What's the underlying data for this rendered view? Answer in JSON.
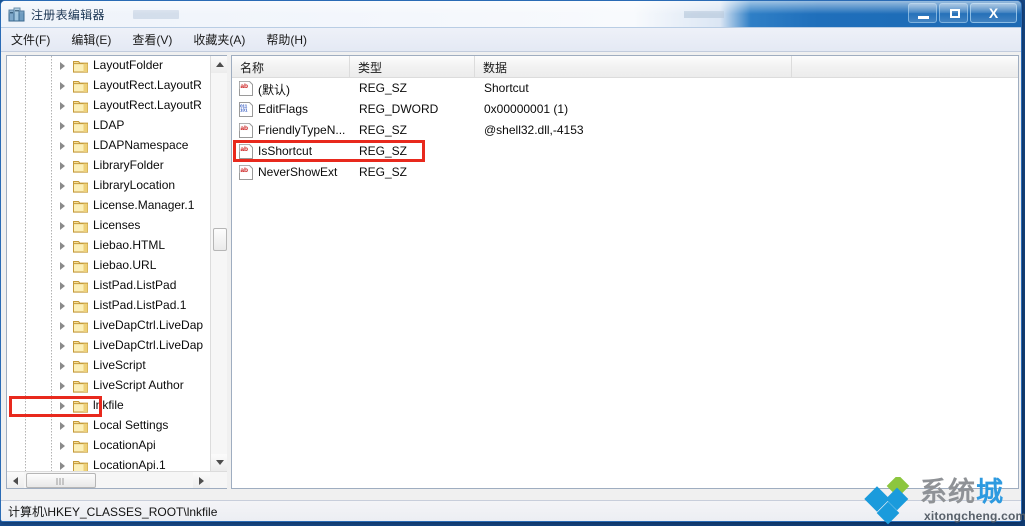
{
  "window": {
    "title": "注册表编辑器",
    "app_icon": "registry-editor-icon",
    "controls": {
      "minimize": "–",
      "maximize": "□",
      "close": "X"
    }
  },
  "menubar": {
    "items": [
      {
        "label": "文件(F)",
        "name": "menu-file"
      },
      {
        "label": "编辑(E)",
        "name": "menu-edit"
      },
      {
        "label": "查看(V)",
        "name": "menu-view"
      },
      {
        "label": "收藏夹(A)",
        "name": "menu-favorites"
      },
      {
        "label": "帮助(H)",
        "name": "menu-help"
      }
    ]
  },
  "tree": {
    "items": [
      {
        "label": "LayoutFolder",
        "highlighted": false
      },
      {
        "label": "LayoutRect.LayoutR",
        "highlighted": false
      },
      {
        "label": "LayoutRect.LayoutR",
        "highlighted": false
      },
      {
        "label": "LDAP",
        "highlighted": false
      },
      {
        "label": "LDAPNamespace",
        "highlighted": false
      },
      {
        "label": "LibraryFolder",
        "highlighted": false
      },
      {
        "label": "LibraryLocation",
        "highlighted": false
      },
      {
        "label": "License.Manager.1",
        "highlighted": false
      },
      {
        "label": "Licenses",
        "highlighted": false
      },
      {
        "label": "Liebao.HTML",
        "highlighted": false
      },
      {
        "label": "Liebao.URL",
        "highlighted": false
      },
      {
        "label": "ListPad.ListPad",
        "highlighted": false
      },
      {
        "label": "ListPad.ListPad.1",
        "highlighted": false
      },
      {
        "label": "LiveDapCtrl.LiveDap",
        "highlighted": false
      },
      {
        "label": "LiveDapCtrl.LiveDap",
        "highlighted": false
      },
      {
        "label": "LiveScript",
        "highlighted": false
      },
      {
        "label": "LiveScript Author",
        "highlighted": false
      },
      {
        "label": "lnkfile",
        "highlighted": true
      },
      {
        "label": "Local Settings",
        "highlighted": false
      },
      {
        "label": "LocationApi",
        "highlighted": false
      },
      {
        "label": "LocationApi.1",
        "highlighted": false
      }
    ]
  },
  "list": {
    "columns": [
      {
        "label": "名称",
        "name": "column-name"
      },
      {
        "label": "类型",
        "name": "column-type"
      },
      {
        "label": "数据",
        "name": "column-data"
      }
    ],
    "rows": [
      {
        "name": "(默认)",
        "type": "REG_SZ",
        "data": "Shortcut",
        "icon": "string-value-icon",
        "highlighted": false
      },
      {
        "name": "EditFlags",
        "type": "REG_DWORD",
        "data": "0x00000001 (1)",
        "icon": "binary-value-icon",
        "highlighted": false
      },
      {
        "name": "FriendlyTypeN...",
        "type": "REG_SZ",
        "data": "@shell32.dll,-4153",
        "icon": "string-value-icon",
        "highlighted": false
      },
      {
        "name": "IsShortcut",
        "type": "REG_SZ",
        "data": "",
        "icon": "string-value-icon",
        "highlighted": true
      },
      {
        "name": "NeverShowExt",
        "type": "REG_SZ",
        "data": "",
        "icon": "string-value-icon",
        "highlighted": false
      }
    ]
  },
  "statusbar": {
    "path": "计算机\\HKEY_CLASSES_ROOT\\lnkfile"
  },
  "watermark": {
    "text_plain": "系统",
    "text_accent": "城",
    "url": "xitongcheng.com",
    "logo": "diamond-logo-icon"
  },
  "colors": {
    "highlight_red": "#e8291d",
    "titlebar_blue": "#1d6ab4",
    "accent_blue": "#2d9ae0",
    "logo_green": "#8cc63e"
  }
}
